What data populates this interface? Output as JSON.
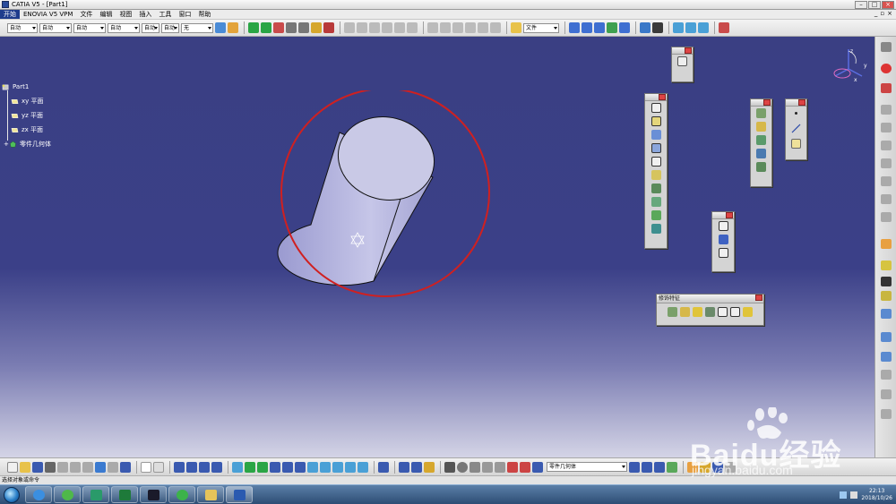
{
  "window": {
    "title": "CATIA V5 - [Part1]"
  },
  "menubar": {
    "items": [
      "开始",
      "ENOVIA V5 VPM",
      "文件",
      "编辑",
      "视图",
      "插入",
      "工具",
      "窗口",
      "帮助"
    ],
    "active_index": 0
  },
  "toolbar_top": {
    "combos": [
      "自动",
      "自动",
      "自动",
      "自动",
      "自动",
      "自动",
      "无",
      "文件"
    ]
  },
  "spec_tree": {
    "root": "Part1",
    "children": [
      {
        "label": "xy 平面",
        "icon": "plane-icon"
      },
      {
        "label": "yz 平面",
        "icon": "plane-icon"
      },
      {
        "label": "zx 平面",
        "icon": "plane-icon"
      },
      {
        "label": "零件几何体",
        "icon": "part-body-icon"
      }
    ]
  },
  "floating_toolbars": {
    "dress_up": {
      "title": "修饰特征"
    }
  },
  "toolbar_bottom": {
    "body_combo": "零件几何体"
  },
  "statusbar": {
    "text": "选择对象或命令"
  },
  "taskbar": {
    "time": "22:13",
    "date": "2018/10/26"
  },
  "watermark": {
    "brand": "Baidu经验",
    "url": "jingyan.baidu.com"
  },
  "colors": {
    "highlight_circle": "#d02020",
    "cylinder_face": "#c9c9e6",
    "canvas_top": "#3a3f83"
  }
}
